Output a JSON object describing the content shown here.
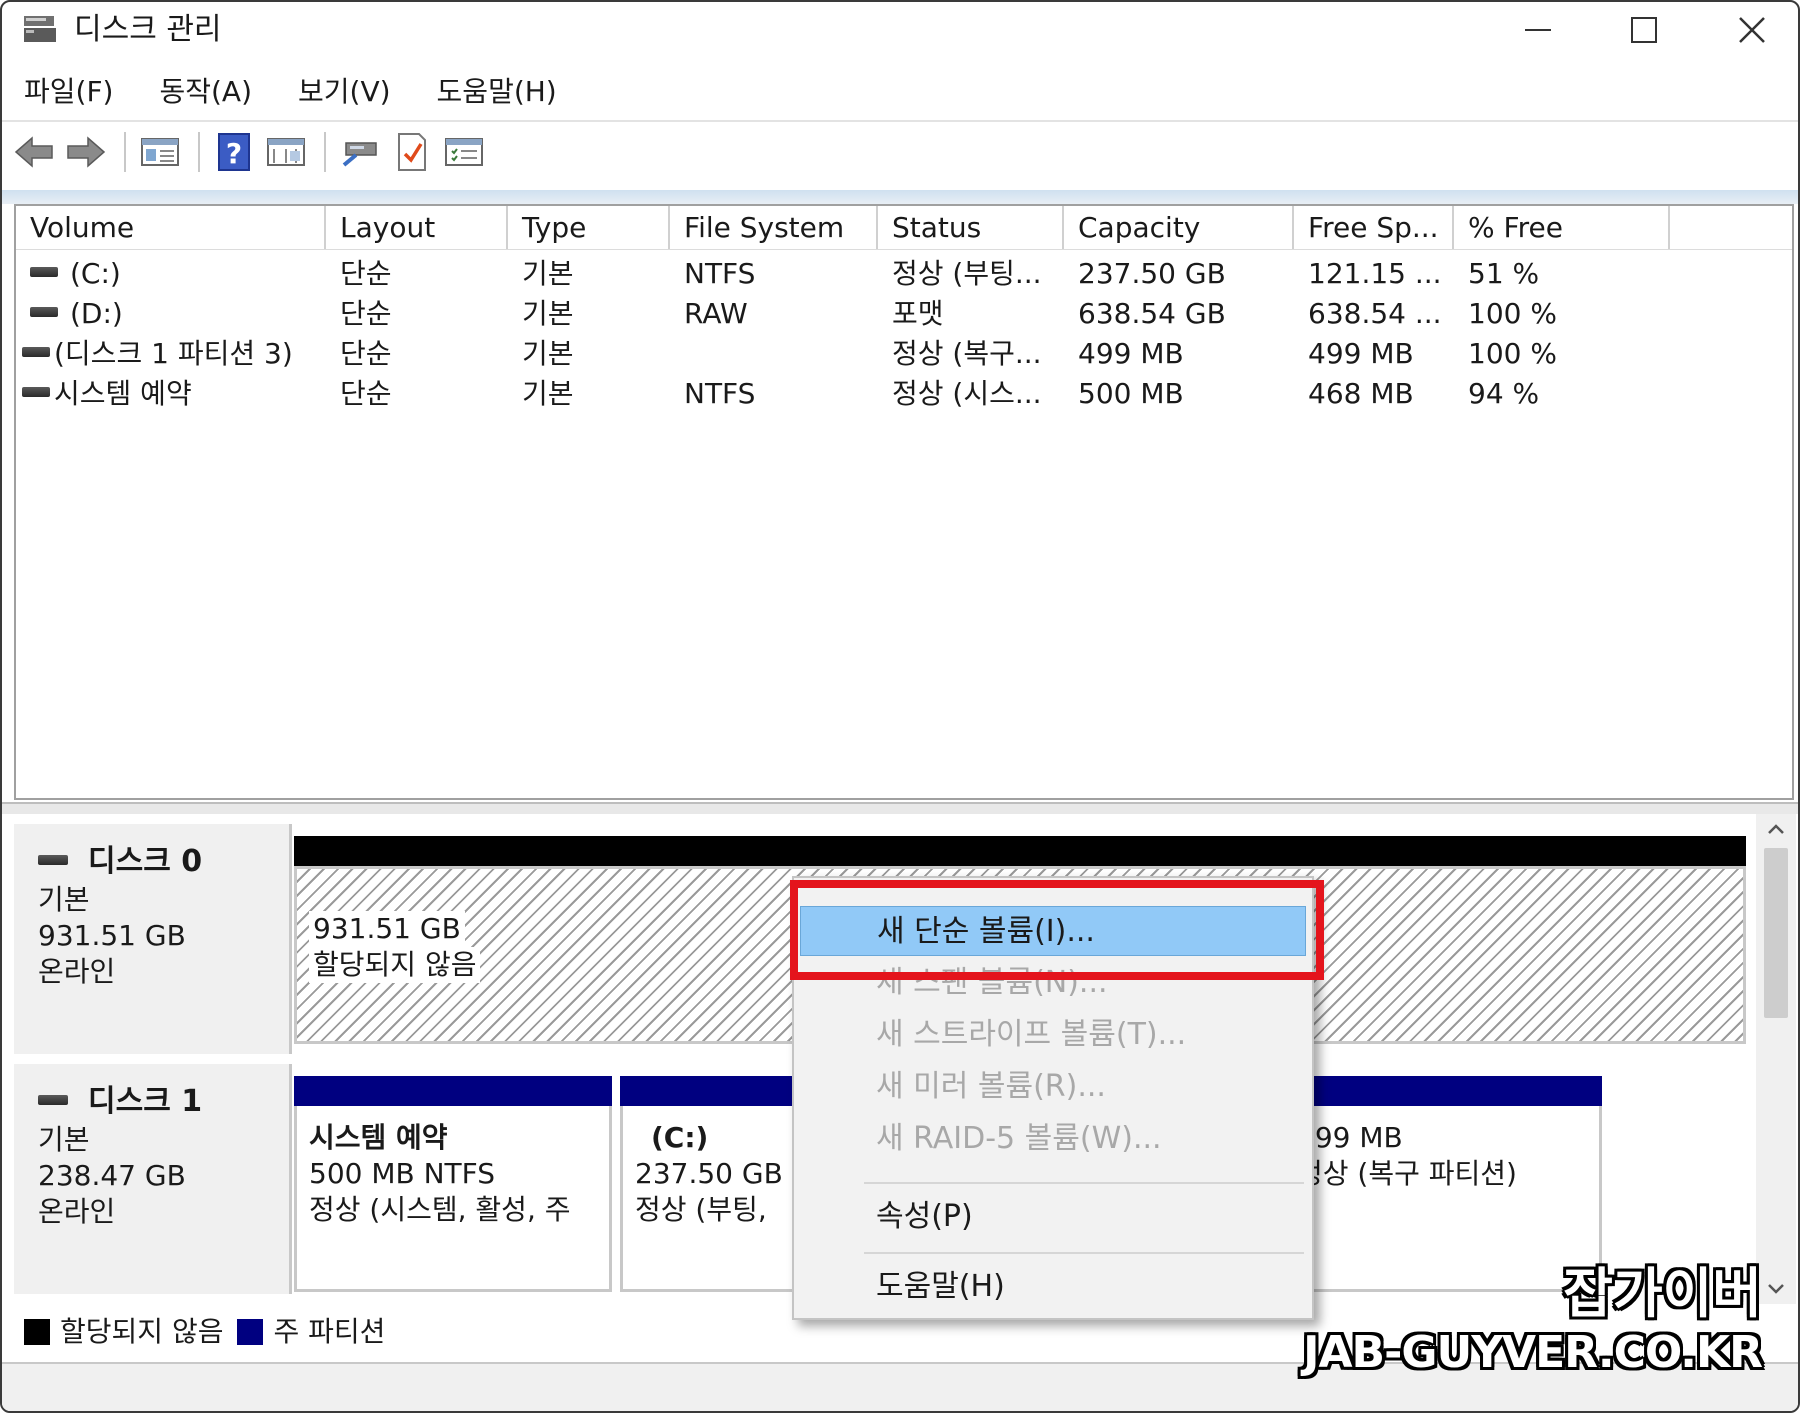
{
  "window": {
    "title": "디스크 관리"
  },
  "menu": [
    "파일(F)",
    "동작(A)",
    "보기(V)",
    "도움말(H)"
  ],
  "toolbar": [
    "back-arrow-icon",
    "forward-arrow-icon",
    "console-tree-icon",
    "help-icon",
    "show-pane-icon",
    "connect-icon",
    "check-document-icon",
    "properties-list-icon"
  ],
  "volume_list": {
    "columns": [
      "Volume",
      "Layout",
      "Type",
      "File System",
      "Status",
      "Capacity",
      "Free Sp...",
      "% Free"
    ],
    "rows": [
      [
        "(C:)",
        "단순",
        "기본",
        "NTFS",
        "정상 (부팅...",
        "237.50 GB",
        "121.15 ...",
        "51 %"
      ],
      [
        "(D:)",
        "단순",
        "기본",
        "RAW",
        "포맷",
        "638.54 GB",
        "638.54 ...",
        "100 %"
      ],
      [
        "(디스크 1 파티션 3)",
        "단순",
        "기본",
        "",
        "정상 (복구...",
        "499 MB",
        "499 MB",
        "100 %"
      ],
      [
        "시스템 예약",
        "단순",
        "기본",
        "NTFS",
        "정상 (시스...",
        "500 MB",
        "468 MB",
        "94 %"
      ]
    ]
  },
  "disks": [
    {
      "name": "디스크 0",
      "type": "기본",
      "size": "931.51 GB",
      "state": "온라인",
      "partitions": [
        {
          "size": "931.51 GB",
          "status": "할당되지 않음"
        }
      ]
    },
    {
      "name": "디스크 1",
      "type": "기본",
      "size": "238.47 GB",
      "state": "온라인",
      "partitions": [
        {
          "title": "시스템 예약",
          "line1": "500 MB NTFS",
          "line2": "정상 (시스템, 활성, 주"
        },
        {
          "title": "(C:)",
          "line1": "237.50 GB N",
          "line2": "정상 (부팅,"
        },
        {
          "title": "",
          "line1": "499 MB",
          "line2": "정상 (복구 파티션)"
        }
      ]
    }
  ],
  "legend": [
    {
      "label": "할당되지 않음",
      "color": "#000000"
    },
    {
      "label": "주 파티션",
      "color": "#000080"
    }
  ],
  "context_menu": {
    "items": [
      {
        "label": "새 단순 볼륨(I)...",
        "enabled": true,
        "highlighted": true
      },
      {
        "label": "새 스팬 볼륨(N)...",
        "enabled": false
      },
      {
        "label": "새 스트라이프 볼륨(T)...",
        "enabled": false
      },
      {
        "label": "새 미러 볼륨(R)...",
        "enabled": false
      },
      {
        "label": "새 RAID-5 볼륨(W)...",
        "enabled": false
      },
      {
        "label": "속성(P)",
        "enabled": true
      },
      {
        "label": "도움말(H)",
        "enabled": true
      }
    ]
  },
  "watermark": {
    "korean": "잡가이버",
    "url": "JAB-GUYVER.CO.KR"
  },
  "colors": {
    "primary_partition": "#000080",
    "unallocated": "#000000",
    "highlight": "#91c9f7",
    "callout": "#e4141c"
  }
}
